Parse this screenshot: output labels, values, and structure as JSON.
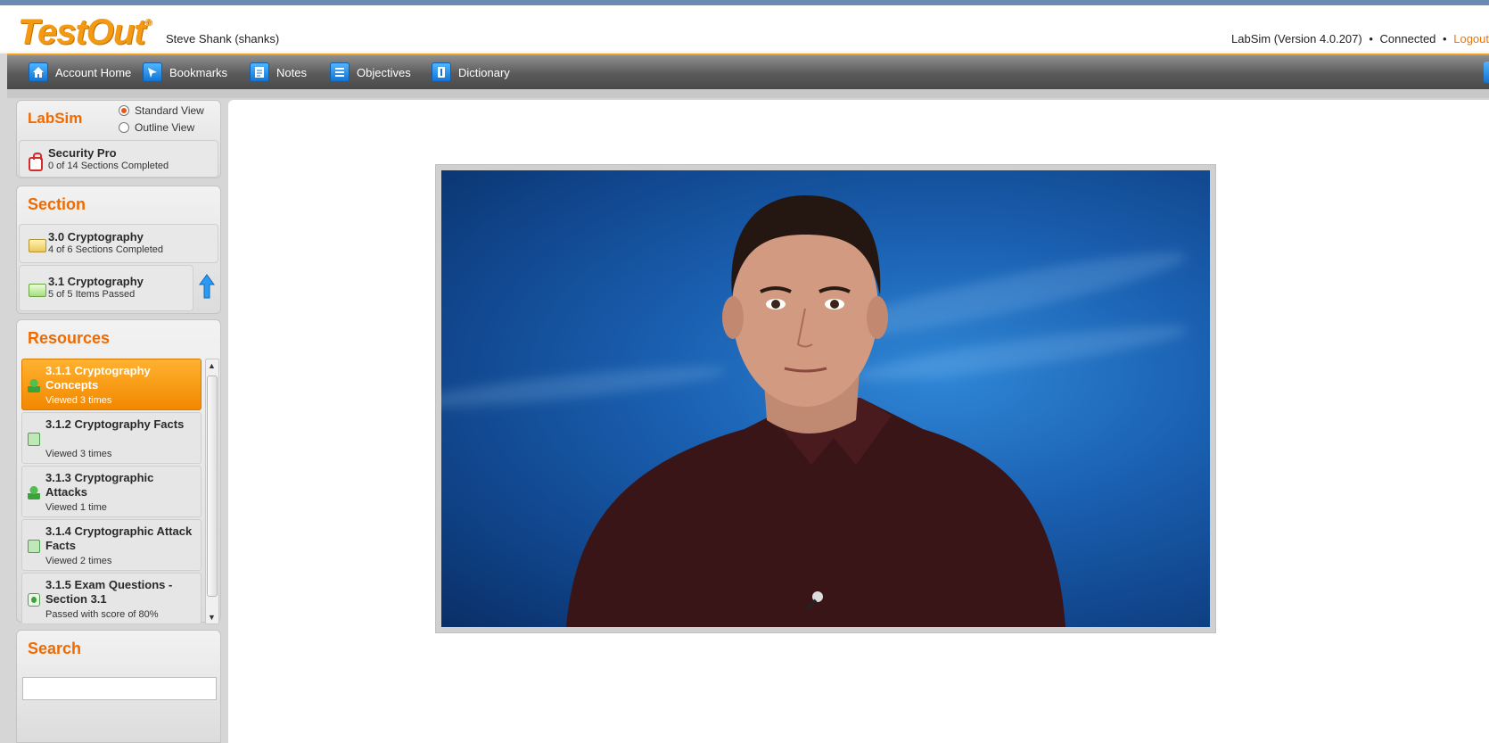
{
  "header": {
    "logo": "TestOut",
    "logo_mark": "®",
    "user": "Steve Shank (shanks)",
    "version": "LabSim (Version 4.0.207)",
    "connection": "Connected",
    "separator": "•",
    "logout": "Logout"
  },
  "toolbar": {
    "items": [
      {
        "label": "Account Home",
        "icon": "home-icon"
      },
      {
        "label": "Bookmarks",
        "icon": "bookmark-icon"
      },
      {
        "label": "Notes",
        "icon": "notes-icon"
      },
      {
        "label": "Objectives",
        "icon": "objectives-icon"
      },
      {
        "label": "Dictionary",
        "icon": "dictionary-icon"
      }
    ]
  },
  "sidebar": {
    "labsim": {
      "title": "LabSim",
      "standard_view": "Standard View",
      "outline_view": "Outline View",
      "selected_view": "Standard View",
      "course_title": "Security Pro",
      "course_progress": "0 of 14 Sections Completed"
    },
    "section": {
      "title": "Section",
      "items": [
        {
          "title": "3.0 Cryptography",
          "sub": "4 of 6 Sections Completed"
        },
        {
          "title": "3.1 Cryptography",
          "sub": "5 of 5 Items Passed"
        }
      ]
    },
    "resources": {
      "title": "Resources",
      "items": [
        {
          "title": "3.1.1 Cryptography Concepts",
          "meta": "Viewed 3 times",
          "icon": "video-person-icon",
          "active": true
        },
        {
          "title": "3.1.2 Cryptography Facts",
          "meta": "Viewed 3 times",
          "icon": "facts-doc-icon",
          "active": false
        },
        {
          "title": "3.1.3 Cryptographic Attacks",
          "meta": "Viewed 1 time",
          "icon": "video-person-icon",
          "active": false
        },
        {
          "title": "3.1.4 Cryptographic Attack Facts",
          "meta": "Viewed 2 times",
          "icon": "facts-doc-icon",
          "active": false
        },
        {
          "title": "3.1.5 Exam Questions - Section 3.1",
          "meta": "Passed with score of 80%",
          "icon": "exam-icon",
          "active": false
        }
      ]
    },
    "search": {
      "title": "Search",
      "value": "",
      "placeholder": ""
    }
  },
  "colors": {
    "accent_orange": "#ef6a00",
    "active_item": "#f28800",
    "toolbar_dark": "#4a4a4a",
    "video_blue": "#1a5fb0"
  }
}
